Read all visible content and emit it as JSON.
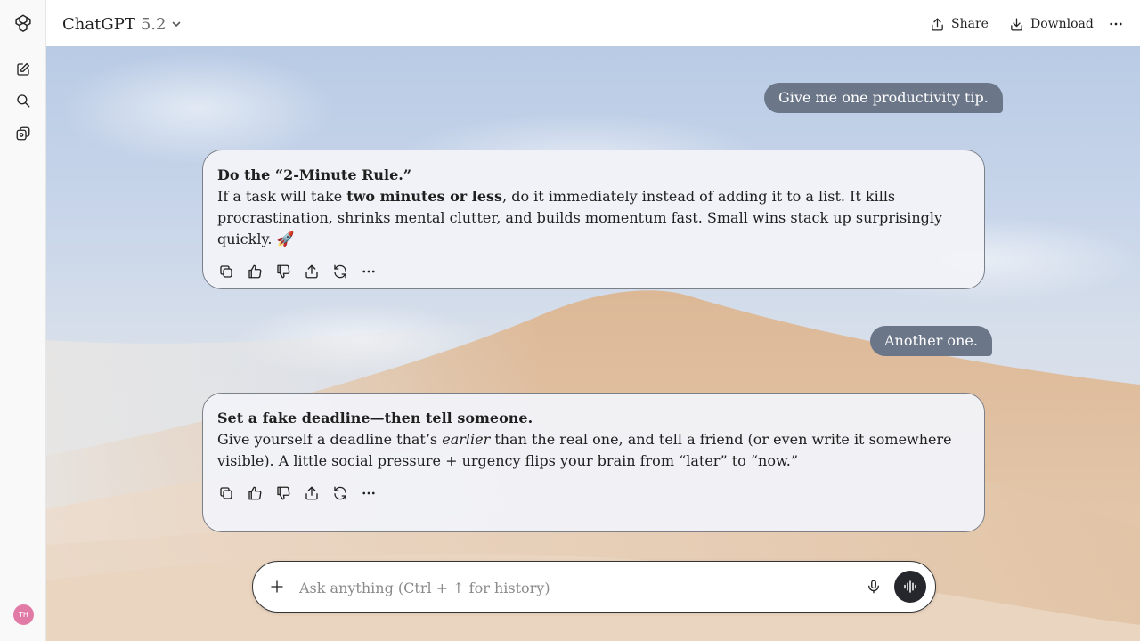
{
  "header": {
    "model_name": "ChatGPT",
    "model_version": "5.2",
    "share_label": "Share",
    "download_label": "Download"
  },
  "sidebar": {
    "avatar_initials": "TH",
    "icons": [
      "openai-logo-icon",
      "new-chat-icon",
      "search-icon",
      "library-icon"
    ]
  },
  "messages": {
    "user1": "Give me one productivity tip.",
    "ai1": {
      "title": "Do the “2-Minute Rule.”",
      "p1": "If a task will take ",
      "b1": "two minutes or less",
      "p2": ", do it immediately instead of adding it to a list. It kills procrastination, shrinks mental clutter, and builds momentum fast. Small wins stack up surprisingly quickly. ",
      "emoji": "🚀"
    },
    "user2": "Another one.",
    "ai2": {
      "title": "Set a fake deadline—then tell someone.",
      "p1": "Give yourself a deadline that’s ",
      "i1": "earlier",
      "p2": " than the real one, and tell a friend (or even write it somewhere visible). A little social pressure + urgency flips your brain from “later” to “now.”"
    }
  },
  "composer": {
    "placeholder": "Ask anything (Ctrl + ↑ for history)"
  },
  "colors": {
    "user_bubble": "#6b7689",
    "voice_button": "#25272c",
    "avatar": "#e27aa6"
  }
}
